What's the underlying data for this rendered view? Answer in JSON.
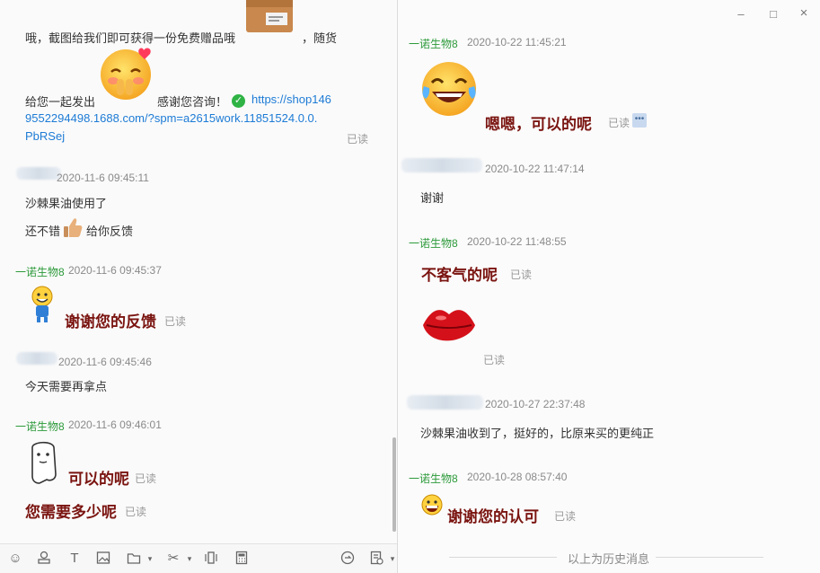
{
  "left": {
    "intro_line1_a": "哦，截图给我们即可获得一份免费赠品哦",
    "intro_line1_b": "，随货",
    "intro_line2": "给您一起发出",
    "intro_thanks": "感谢您咨询！",
    "link_line1": "https://shop146",
    "link_line2": "9552294498.1688.com/?spm=a2615work.11851524.0.0.",
    "link_line3": "PbRSej",
    "read1": "已读",
    "m1_ts": "2020-11-6 09:45:11",
    "m1_text": "沙棘果油使用了",
    "m1_text2a": "还不错",
    "m1_text2b": "给你反馈",
    "m2_sender": "一诺生物8",
    "m2_ts": "2020-11-6 09:45:37",
    "m2_text": "谢谢您的反馈",
    "m2_read": "已读",
    "m3_ts": "2020-11-6 09:45:46",
    "m3_text": "今天需要再拿点",
    "m4_sender": "一诺生物8",
    "m4_ts": "2020-11-6 09:46:01",
    "m4_text": "可以的呢",
    "m4_read": "已读",
    "m5_text": "您需要多少呢",
    "m5_read": "已读"
  },
  "right": {
    "r1_sender": "一诺生物8",
    "r1_ts": "2020-10-22 11:45:21",
    "r1_text": "嗯嗯，可以的呢",
    "r1_read": "已读",
    "r2_ts": "2020-10-22 11:47:14",
    "r2_text": "谢谢",
    "r3_sender": "一诺生物8",
    "r3_ts": "2020-10-22 11:48:55",
    "r3_text": "不客气的呢",
    "r3_read": "已读",
    "r3_read2": "已读",
    "r4_ts": "2020-10-27 22:37:48",
    "r4_text": "沙棘果油收到了，挺好的，比原来买的更纯正",
    "r5_sender": "一诺生物8",
    "r5_ts": "2020-10-28 08:57:40",
    "r5_text": "谢谢您的认可",
    "r5_read": "已读",
    "history": "以上为历史消息"
  },
  "toolbar": {
    "icons": [
      "emoji-icon",
      "stamp-icon",
      "text-icon",
      "image-icon",
      "folder-icon",
      "scissors-icon",
      "shake-icon",
      "calculator-icon",
      "history-icon",
      "record-icon"
    ]
  },
  "window": {
    "minimize": "–",
    "maximize": "□",
    "close": "×"
  }
}
